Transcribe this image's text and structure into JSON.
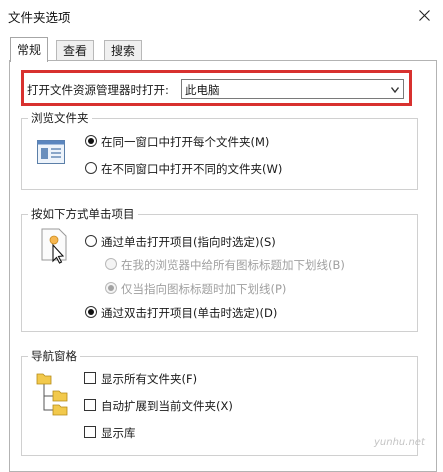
{
  "window": {
    "title": "文件夹选项"
  },
  "tabs": [
    {
      "label": "常规",
      "active": true
    },
    {
      "label": "查看",
      "active": false
    },
    {
      "label": "搜索",
      "active": false
    }
  ],
  "open_explorer": {
    "label": "打开文件资源管理器时打开:",
    "value": "此电脑"
  },
  "browse_folders": {
    "title": "浏览文件夹",
    "options": [
      {
        "label": "在同一窗口中打开每个文件夹(M)",
        "checked": true
      },
      {
        "label": "在不同窗口中打开不同的文件夹(W)",
        "checked": false
      }
    ]
  },
  "click_items": {
    "title": "按如下方式单击项目",
    "single_click": {
      "label": "通过单击打开项目(指向时选定)(S)",
      "checked": false
    },
    "sub_options": [
      {
        "label": "在我的浏览器中给所有图标标题加下划线(B)",
        "checked": false,
        "disabled": true
      },
      {
        "label": "仅当指向图标标题时加下划线(P)",
        "checked": true,
        "disabled": true
      }
    ],
    "double_click": {
      "label": "通过双击打开项目(单击时选定)(D)",
      "checked": true
    }
  },
  "nav_pane": {
    "title": "导航窗格",
    "options": [
      {
        "label": "显示所有文件夹(F)",
        "checked": false
      },
      {
        "label": "自动扩展到当前文件夹(X)",
        "checked": false
      },
      {
        "label": "显示库",
        "checked": false
      }
    ]
  },
  "watermark": "yunhu.net",
  "colors": {
    "highlight_frame": "#d8312f",
    "folder": "#f2c94c"
  }
}
